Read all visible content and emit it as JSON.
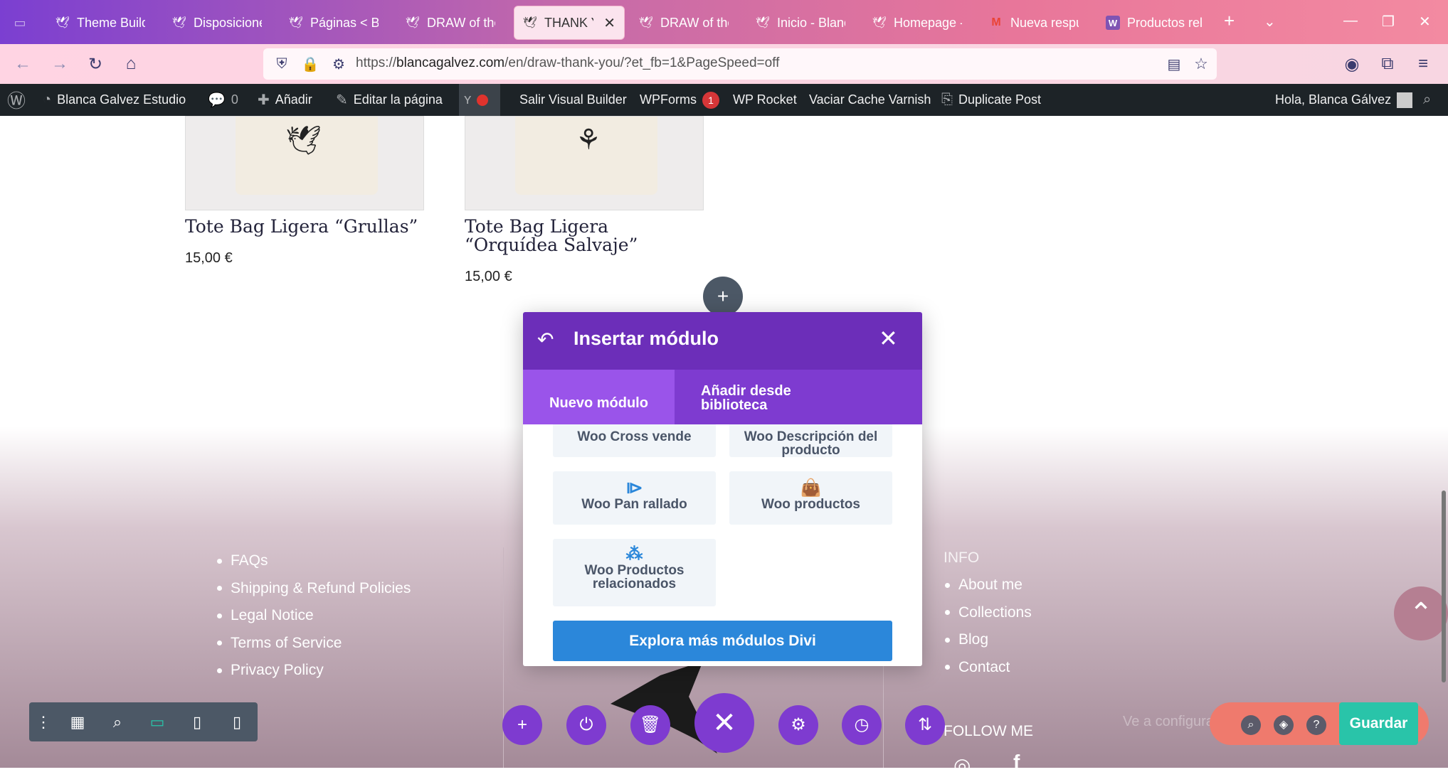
{
  "tabs": [
    {
      "label": "Theme Builde",
      "icon": "bird-icon",
      "active": false
    },
    {
      "label": "Disposiciones",
      "icon": "bird-icon",
      "active": false
    },
    {
      "label": "Páginas < Bla",
      "icon": "bird-icon",
      "active": false
    },
    {
      "label": "DRAW of the",
      "icon": "bird-icon",
      "active": false
    },
    {
      "label": "THANK YO",
      "icon": "bird-icon",
      "active": true
    },
    {
      "label": "DRAW of the",
      "icon": "bird-icon",
      "active": false
    },
    {
      "label": "Inicio - Blanca",
      "icon": "bird-icon",
      "active": false
    },
    {
      "label": "Homepage -",
      "icon": "bird-icon",
      "active": false
    },
    {
      "label": "Nueva respue",
      "icon": "gmail-icon",
      "active": false
    },
    {
      "label": "Productos rel",
      "icon": "woo-icon",
      "active": false
    }
  ],
  "address": {
    "prefix": "https://",
    "domain": "blancagalvez.com",
    "path": "/en/draw-thank-you/?et_fb=1&PageSpeed=off"
  },
  "adminbar": {
    "site": "Blanca Galvez Estudio",
    "comments": "0",
    "add": "Añadir",
    "edit": "Editar la página",
    "exit_builder": "Salir Visual Builder",
    "wpforms": "WPForms",
    "wpforms_count": "1",
    "rocket": "WP Rocket",
    "varnish": "Vaciar Cache Varnish",
    "duplicate": "Duplicate Post",
    "greeting": "Hola, Blanca Gálvez"
  },
  "products": [
    {
      "title": "Tote Bag Ligera “Grullas”",
      "price": "15,00 €"
    },
    {
      "title": "Tote Bag Ligera “Orquídea Salvaje”",
      "price": "15,00 €"
    }
  ],
  "footer": {
    "links": [
      "FAQs",
      "Shipping & Refund Policies",
      "Legal Notice",
      "Terms of Service",
      "Privacy Policy"
    ],
    "info_heading": "INFO",
    "info_links": [
      "About me",
      "Collections",
      "Blog",
      "Contact"
    ],
    "follow_heading": "FOLLOW ME",
    "ghost_text": "Ve a configuración y guarda a"
  },
  "modal": {
    "title": "Insertar módulo",
    "tab_new": "Nuevo módulo",
    "tab_library": "Añadir desde biblioteca",
    "modules": [
      {
        "label": "Woo Cross vende",
        "icon": ""
      },
      {
        "label": "Woo Descripción del producto",
        "icon": ""
      },
      {
        "label": "Woo Pan rallado",
        "icon": "breadcrumb-icon"
      },
      {
        "label": "Woo productos",
        "icon": "shopping-bag-icon"
      },
      {
        "label": "Woo Productos relacionados",
        "icon": "related-products-icon"
      }
    ],
    "explore": "Explora más módulos Divi"
  },
  "builder": {
    "save": "Guardar"
  }
}
